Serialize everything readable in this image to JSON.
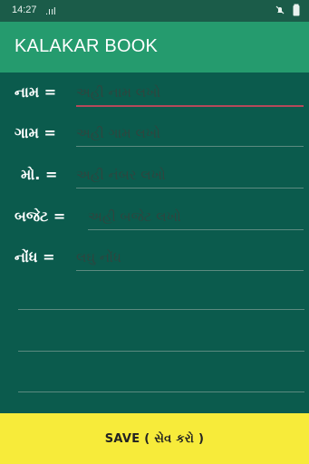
{
  "statusbar": {
    "time": "14:27",
    "signal": ".ııl"
  },
  "header": {
    "title": "KALAKAR BOOK"
  },
  "form": {
    "name": {
      "label": "નામ =",
      "placeholder": "અહી નામ લખો"
    },
    "village": {
      "label": "ગામ =",
      "placeholder": "અહી ગામ લખો"
    },
    "mobile": {
      "label": "મો. =",
      "placeholder": "અહી નંબર લખો"
    },
    "budget": {
      "label": "બજેટ =",
      "placeholder": "અહી બજેટ લખો"
    },
    "note": {
      "label": "નોંધ =",
      "placeholder": "લઘુ નોંધ"
    }
  },
  "actions": {
    "save_label": "SAVE  ( સેવ કરો )"
  },
  "colors": {
    "statusbar": "#1b5c49",
    "appbar": "#259b6e",
    "background": "#0b5b4d",
    "save_button": "#f7eb3a",
    "active_underline": "#b5485a"
  }
}
